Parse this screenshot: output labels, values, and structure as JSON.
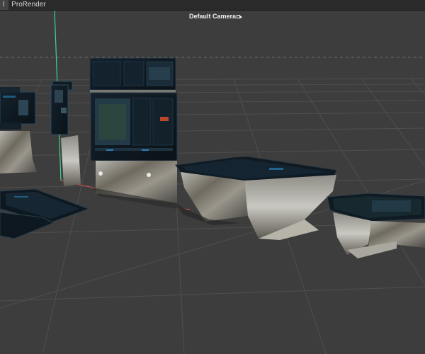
{
  "menubar": {
    "items": [
      {
        "label": "l"
      },
      {
        "label": "ProRender"
      }
    ]
  },
  "viewport": {
    "camera_label": "Default Camera",
    "camera_icon": "camera-icon"
  },
  "colors": {
    "background": "#3d3d3d",
    "grid": "#4d4d4d",
    "y_axis": "#3fd39b",
    "x_axis": "#e05050",
    "screen": "#0f1a24",
    "screen_accent": "#2a7fb2"
  }
}
